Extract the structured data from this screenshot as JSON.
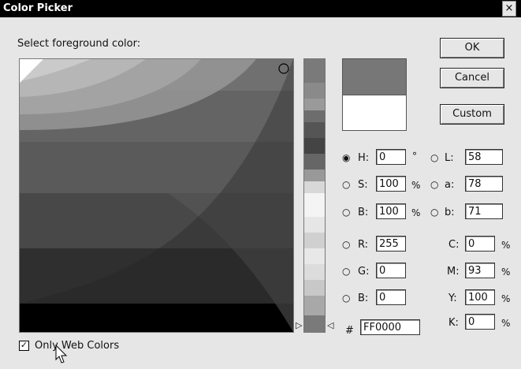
{
  "window": {
    "title": "Color Picker",
    "close_glyph": "×"
  },
  "prompt": "Select foreground color:",
  "buttons": {
    "ok": "OK",
    "cancel": "Cancel",
    "custom": "Custom"
  },
  "hsb": [
    {
      "label": "H:",
      "value": "0",
      "unit": "°",
      "selected": true
    },
    {
      "label": "S:",
      "value": "100",
      "unit": "%",
      "selected": false
    },
    {
      "label": "B:",
      "value": "100",
      "unit": "%",
      "selected": false
    }
  ],
  "lab": [
    {
      "label": "L:",
      "value": "58"
    },
    {
      "label": "a:",
      "value": "78"
    },
    {
      "label": "b:",
      "value": "71"
    }
  ],
  "rgb": [
    {
      "label": "R:",
      "value": "255"
    },
    {
      "label": "G:",
      "value": "0"
    },
    {
      "label": "B:",
      "value": "0"
    }
  ],
  "cmyk": [
    {
      "label": "C:",
      "value": "0",
      "unit": "%"
    },
    {
      "label": "M:",
      "value": "93",
      "unit": "%"
    },
    {
      "label": "Y:",
      "value": "100",
      "unit": "%"
    },
    {
      "label": "K:",
      "value": "0",
      "unit": "%"
    }
  ],
  "hex": {
    "label": "#",
    "value": "FF0000"
  },
  "web_colors": {
    "label": "Only Web Colors",
    "checked": true
  },
  "icons": {
    "radio_on": "◉",
    "radio_off": "○",
    "check": "✓",
    "slider_left": "▷",
    "slider_right": "◁"
  }
}
